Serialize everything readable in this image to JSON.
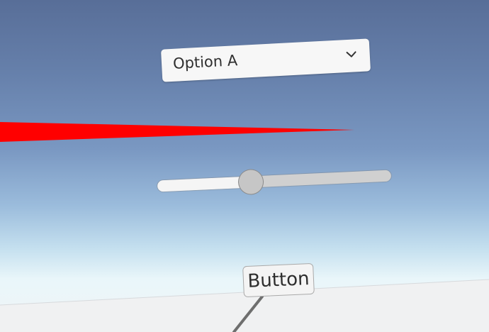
{
  "dropdown": {
    "selected_value": "Option A",
    "arrow_icon": "chevron-down-icon"
  },
  "slider": {
    "value_fraction": 0.4
  },
  "button": {
    "label": "Button"
  },
  "colors": {
    "laser_pointer": "#ff0000",
    "sky_top": "#586e98",
    "sky_horizon": "#e9f6fa",
    "panel_background": "#f7f7f7",
    "slider_track": "#d0d0d0",
    "slider_fill": "#f5f5f5",
    "slider_thumb": "#c6c6c6"
  }
}
